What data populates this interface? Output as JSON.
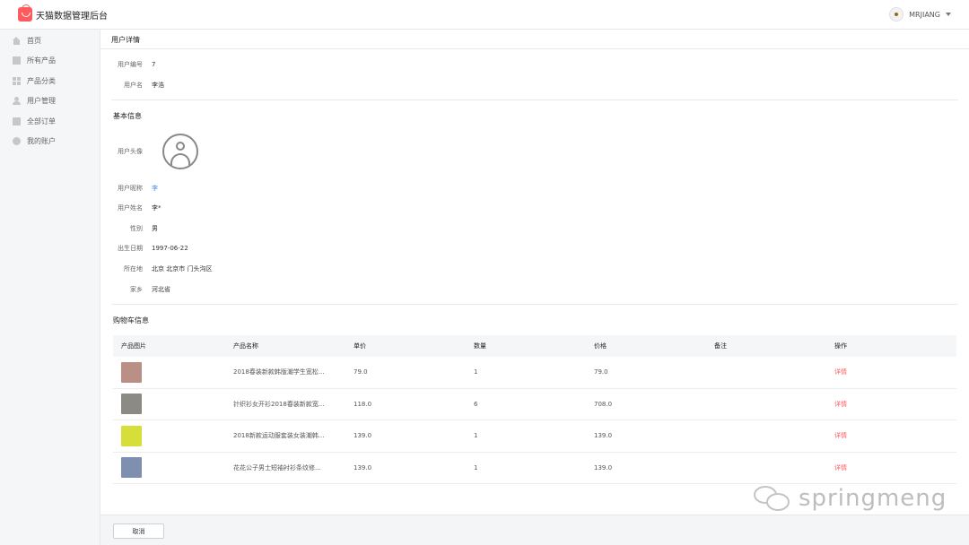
{
  "app": {
    "title": "天猫数据管理后台"
  },
  "header": {
    "username": "MRJIANG"
  },
  "sidebar": {
    "items": [
      {
        "label": "首页",
        "icon": "home-icon"
      },
      {
        "label": "所有产品",
        "icon": "product-icon"
      },
      {
        "label": "产品分类",
        "icon": "category-icon"
      },
      {
        "label": "用户管理",
        "icon": "user-icon"
      },
      {
        "label": "全部订单",
        "icon": "order-icon"
      },
      {
        "label": "我的账户",
        "icon": "gear-icon"
      }
    ]
  },
  "page": {
    "title": "用户详情"
  },
  "user_info": {
    "id_label": "用户编号",
    "id_value": "7",
    "name_label": "用户名",
    "name_value": "李浩"
  },
  "basic": {
    "section_title": "基本信息",
    "avatar_label": "用户头像",
    "nickname_label": "用户昵称",
    "nickname_value": "李",
    "realname_label": "用户姓名",
    "realname_value": "李*",
    "gender_label": "性别",
    "gender_value": "男",
    "birthday_label": "出生日期",
    "birthday_value": "1997-06-22",
    "location_label": "所在地",
    "location_value": "北京 北京市 门头沟区",
    "hometown_label": "家乡",
    "hometown_value": "河北省"
  },
  "cart": {
    "section_title": "购物车信息",
    "columns": [
      "产品图片",
      "产品名称",
      "单价",
      "数量",
      "价格",
      "备注",
      "操作"
    ],
    "rows": [
      {
        "name": "2018春装新款韩版潮学生宽松...",
        "unit_price": "79.0",
        "qty": "1",
        "price": "79.0",
        "note": "",
        "action": "详情",
        "thumb_color": "#b98f86"
      },
      {
        "name": "针织衫女开衫2018春装新款宽...",
        "unit_price": "118.0",
        "qty": "6",
        "price": "708.0",
        "note": "",
        "action": "详情",
        "thumb_color": "#8c8a85"
      },
      {
        "name": "2018新款运动服套装女装潮韩...",
        "unit_price": "139.0",
        "qty": "1",
        "price": "139.0",
        "note": "",
        "action": "详情",
        "thumb_color": "#d6df3a"
      },
      {
        "name": "花花公子男士短袖衬衫条纹修...",
        "unit_price": "139.0",
        "qty": "1",
        "price": "139.0",
        "note": "",
        "action": "详情",
        "thumb_color": "#7f8fb0"
      }
    ]
  },
  "footer": {
    "cancel_label": "取消"
  },
  "watermark": {
    "text": "springmeng"
  }
}
